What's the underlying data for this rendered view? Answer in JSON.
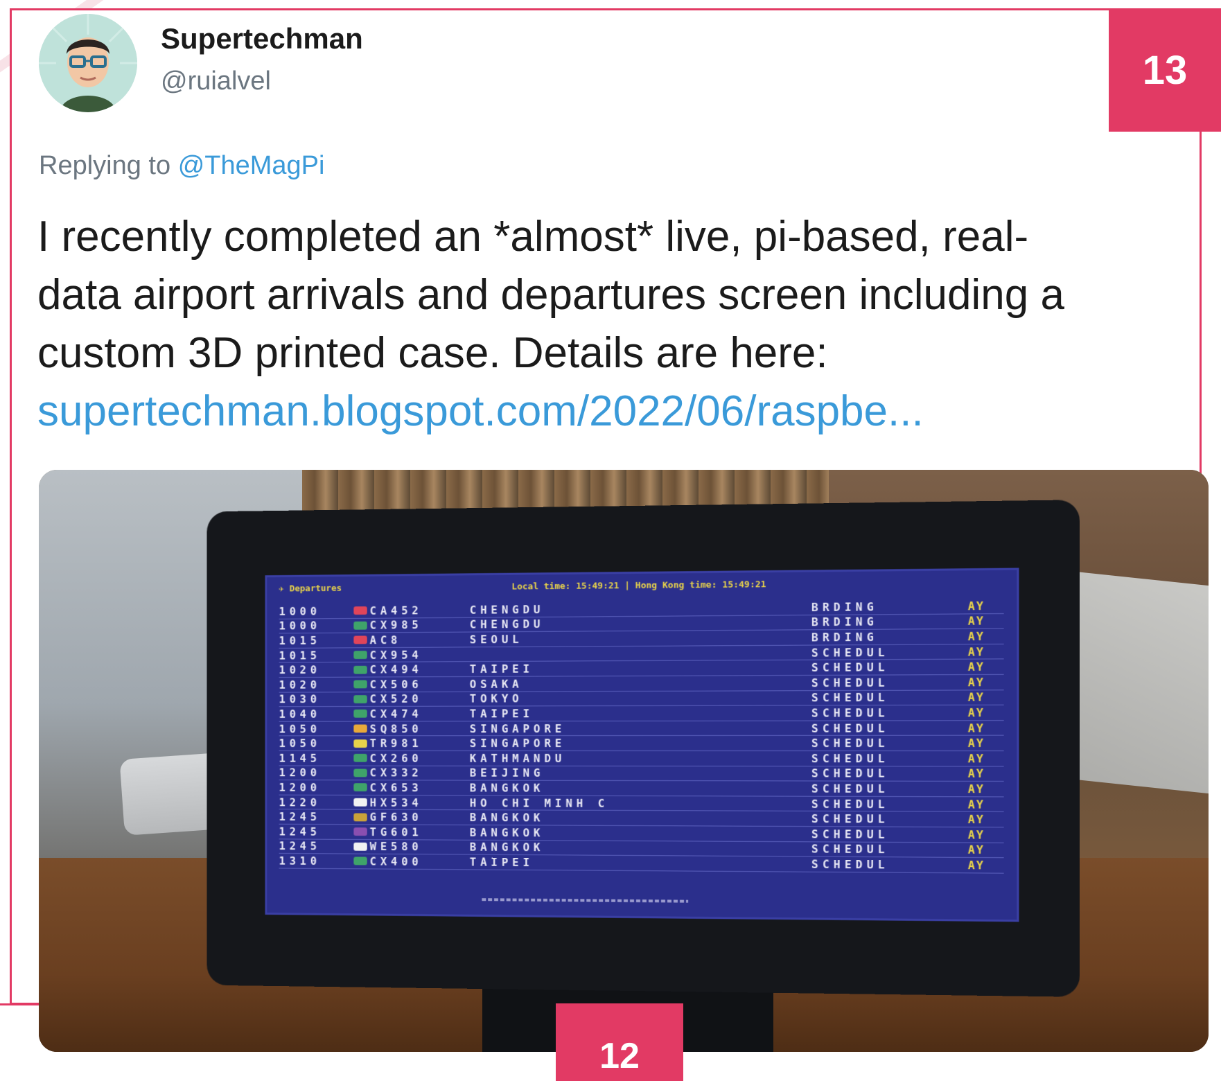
{
  "tweet": {
    "author_name": "Supertechman",
    "author_handle": "@ruialvel",
    "replying_prefix": "Replying to",
    "replying_mention": "@TheMagPi",
    "text_lines": [
      "I recently completed an *almost* live, pi-based, real-",
      "data airport arrivals and departures screen including a",
      "custom 3D printed case. Details are here:"
    ],
    "link": "supertechman.blogspot.com/2022/06/raspbe..."
  },
  "badges": {
    "top_right": "13",
    "bottom": "12"
  },
  "accent_color": "#e23a64",
  "link_color": "#3a9ad9",
  "board": {
    "title": "Departures",
    "clock": "Local time: 15:49:21 | Hong Kong time: 15:49:21",
    "rows": [
      {
        "time": "1000",
        "flight": "CA452",
        "dest": "CHENGDU",
        "status": "BRDING",
        "flag": "AY",
        "logo": "#e0455a"
      },
      {
        "time": "1000",
        "flight": "CX985",
        "dest": "CHENGDU",
        "status": "BRDING",
        "flag": "AY",
        "logo": "#3fa36a"
      },
      {
        "time": "1015",
        "flight": "AC8",
        "dest": "SEOUL",
        "status": "BRDING",
        "flag": "AY",
        "logo": "#e0455a"
      },
      {
        "time": "1015",
        "flight": "CX954",
        "dest": "",
        "status": "SCHEDUL",
        "flag": "AY",
        "logo": "#3fa36a"
      },
      {
        "time": "1020",
        "flight": "CX494",
        "dest": "TAIPEI",
        "status": "SCHEDUL",
        "flag": "AY",
        "logo": "#3fa36a"
      },
      {
        "time": "1020",
        "flight": "CX506",
        "dest": "OSAKA",
        "status": "SCHEDUL",
        "flag": "AY",
        "logo": "#3fa36a"
      },
      {
        "time": "1030",
        "flight": "CX520",
        "dest": "TOKYO",
        "status": "SCHEDUL",
        "flag": "AY",
        "logo": "#3fa36a"
      },
      {
        "time": "1040",
        "flight": "CX474",
        "dest": "TAIPEI",
        "status": "SCHEDUL",
        "flag": "AY",
        "logo": "#3fa36a"
      },
      {
        "time": "1050",
        "flight": "SQ850",
        "dest": "SINGAPORE",
        "status": "SCHEDUL",
        "flag": "AY",
        "logo": "#e8a93a"
      },
      {
        "time": "1050",
        "flight": "TR981",
        "dest": "SINGAPORE",
        "status": "SCHEDUL",
        "flag": "AY",
        "logo": "#e8d34a"
      },
      {
        "time": "1145",
        "flight": "CX260",
        "dest": "KATHMANDU",
        "status": "SCHEDUL",
        "flag": "AY",
        "logo": "#3fa36a"
      },
      {
        "time": "1200",
        "flight": "CX332",
        "dest": "BEIJING",
        "status": "SCHEDUL",
        "flag": "AY",
        "logo": "#3fa36a"
      },
      {
        "time": "1200",
        "flight": "CX653",
        "dest": "BANGKOK",
        "status": "SCHEDUL",
        "flag": "AY",
        "logo": "#3fa36a"
      },
      {
        "time": "1220",
        "flight": "HX534",
        "dest": "HO CHI MINH C",
        "status": "SCHEDUL",
        "flag": "AY",
        "logo": "#f2f2f2"
      },
      {
        "time": "1245",
        "flight": "GF630",
        "dest": "BANGKOK",
        "status": "SCHEDUL",
        "flag": "AY",
        "logo": "#c9a23a"
      },
      {
        "time": "1245",
        "flight": "TG601",
        "dest": "BANGKOK",
        "status": "SCHEDUL",
        "flag": "AY",
        "logo": "#8a4fb0"
      },
      {
        "time": "1245",
        "flight": "WE580",
        "dest": "BANGKOK",
        "status": "SCHEDUL",
        "flag": "AY",
        "logo": "#f2f2f2"
      },
      {
        "time": "1310",
        "flight": "CX400",
        "dest": "TAIPEI",
        "status": "SCHEDUL",
        "flag": "AY",
        "logo": "#3fa36a"
      }
    ]
  }
}
